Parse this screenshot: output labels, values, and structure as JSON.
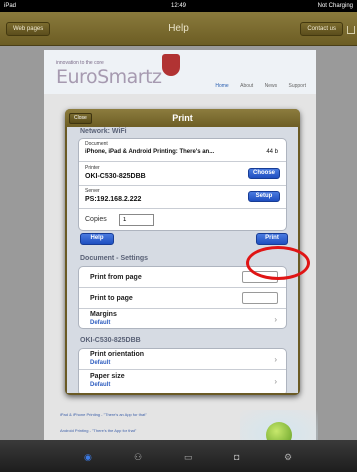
{
  "statusbar": {
    "device": "iPad",
    "wifi_icon": "wifi-icon",
    "time": "12:49",
    "battery": "Not Charging"
  },
  "navbar": {
    "title": "Help",
    "left_button": "Web pages",
    "right_button": "Contact us",
    "share_icon": "share-icon"
  },
  "site": {
    "tagline": "innovation to the core",
    "logo": "EuroSmartz",
    "nav": [
      "Home",
      "About",
      "News",
      "Support"
    ],
    "links": [
      "iPad & iPhone Printing - \"There's an App for that\"",
      "Android Printing - \"There's the App for that\""
    ]
  },
  "popup": {
    "title": "Print",
    "close": "Close",
    "network": "Network: WiFi",
    "document_label": "Document",
    "document_value": "iPhone, iPad & Android Printing: There's an...",
    "pages": "44 b",
    "printer_label": "Printer",
    "printer_value": "OKI-C530-825DBB",
    "choose": "Choose",
    "server_label": "Server",
    "server_value": "PS:192.168.2.222",
    "setup": "Setup",
    "copies_label": "Copies",
    "copies_value": "1",
    "help": "Help",
    "print": "Print",
    "doc_settings": "Document - Settings",
    "print_from_page": "Print from page",
    "print_to_page": "Print to page",
    "margins": "Margins",
    "margins_value": "Default",
    "printer_section": "OKI-C530-825DBB",
    "orientation": "Print orientation",
    "orientation_value": "Default",
    "paper_size": "Paper size",
    "paper_size_value": "Default"
  },
  "dock": {
    "icons": [
      "globe-icon",
      "people-icon",
      "cards-icon",
      "camera-icon",
      "gear-icon"
    ]
  },
  "colors": {
    "accent": "#2f5ec0",
    "header": "#7b6b2e",
    "highlight": "#e01515"
  }
}
